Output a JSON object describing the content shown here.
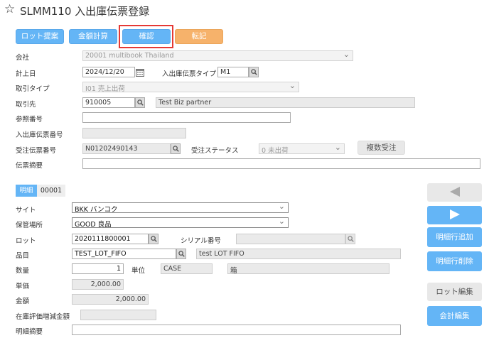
{
  "title": {
    "text": "SLMM110 入出庫伝票登録"
  },
  "toolbar": {
    "lot_proposal": "ロット提案",
    "amount_calc": "金額計算",
    "confirm": "確認",
    "post": "転記"
  },
  "header": {
    "company": {
      "label": "会社",
      "value": "20001 multibook Thailand"
    },
    "posting_date": {
      "label": "計上日",
      "value": "2024/12/20"
    },
    "slip_type": {
      "label": "入出庫伝票タイプ",
      "value": "M1"
    },
    "trade_type": {
      "label": "取引タイプ",
      "value": "I01 売上出荷"
    },
    "partner": {
      "label": "取引先",
      "code": "910005",
      "name": "Test Biz partner"
    },
    "reference": {
      "label": "参照番号",
      "value": ""
    },
    "slip_no": {
      "label": "入出庫伝票番号",
      "value": ""
    },
    "order_no": {
      "label": "受注伝票番号",
      "value": "N01202490143"
    },
    "order_status": {
      "label": "受注ステータス",
      "value": "0 未出荷"
    },
    "multi_order": "複数受注",
    "memo": {
      "label": "伝票摘要",
      "value": ""
    }
  },
  "detail": {
    "tab_label": "明細",
    "tab_number": "00001",
    "site": {
      "label": "サイト",
      "value": "BKK バンコク"
    },
    "location": {
      "label": "保管場所",
      "value": "GOOD 良品"
    },
    "lot": {
      "label": "ロット",
      "value": "2020111800001"
    },
    "serial": {
      "label": "シリアル番号",
      "value": ""
    },
    "item": {
      "label": "品目",
      "code": "TEST_LOT_FIFO",
      "name": "test LOT FIFO"
    },
    "quantity": {
      "label": "数量",
      "value": "1"
    },
    "unit": {
      "label": "単位",
      "code": "CASE",
      "name": "箱"
    },
    "unit_price": {
      "label": "単価",
      "value": "2,000.00"
    },
    "amount": {
      "label": "金額",
      "value": "2,000.00"
    },
    "valuation": {
      "label": "在庫評価増減金額",
      "value": ""
    },
    "line_memo": {
      "label": "明細摘要",
      "value": ""
    }
  },
  "side_buttons": {
    "add_row": "明細行追加",
    "delete_row": "明細行削除",
    "lot_edit": "ロット編集",
    "account_edit": "会計編集"
  },
  "icons": {
    "star": "star-icon",
    "search": "search-icon",
    "calendar": "calendar-icon",
    "prev": "triangle-left-icon",
    "next": "triangle-right-icon"
  },
  "colors": {
    "primary": "#64b5f6",
    "post": "#f6b26b",
    "highlight": "#e53935"
  }
}
